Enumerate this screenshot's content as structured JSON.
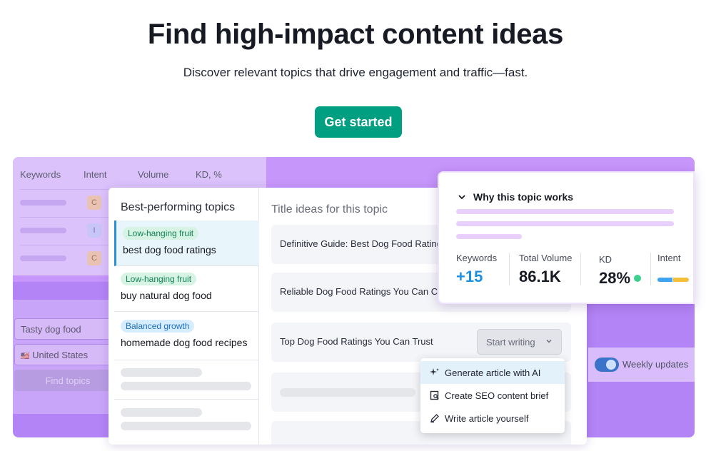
{
  "hero": {
    "title": "Find high-impact content ideas",
    "subtitle": "Discover relevant topics that drive engagement and traffic—fast.",
    "cta_label": "Get started"
  },
  "back_table": {
    "headers": [
      "Keywords",
      "Intent",
      "Volume",
      "KD, %"
    ],
    "badges": [
      "C",
      "I",
      "C"
    ]
  },
  "back_form": {
    "topic_value": "Tasty dog food",
    "country_value": "United States",
    "flag": "🇺🇸",
    "button_label": "Find topics"
  },
  "topics_panel": {
    "title": "Best-performing topics",
    "topics": [
      {
        "tag": "Low-hanging fruit",
        "name": "best dog food ratings"
      },
      {
        "tag": "Low-hanging fruit",
        "name": "buy natural dog food"
      },
      {
        "tag": "Balanced growth",
        "name": "homemade dog food recipes"
      }
    ]
  },
  "ideas_panel": {
    "title": "Title ideas for this topic",
    "ideas": [
      "Definitive Guide: Best Dog Food Ratings",
      "Reliable Dog Food Ratings You Can Count On",
      "Top Dog Food Ratings You Can Trust"
    ],
    "start_writing_label": "Start writing"
  },
  "dropdown": {
    "items": [
      "Generate article with AI",
      "Create SEO content brief",
      "Write article yourself"
    ]
  },
  "why_card": {
    "title": "Why this topic works",
    "metrics": [
      {
        "label": "Keywords",
        "value": "+15"
      },
      {
        "label": "Total Volume",
        "value": "86.1K"
      },
      {
        "label": "KD",
        "value": "28%"
      },
      {
        "label": "Intent",
        "value": ""
      }
    ]
  },
  "weekly": {
    "label": "Weekly updates",
    "enabled": true
  },
  "colors": {
    "cta": "#009f81",
    "stage": "#b384f5",
    "accent_blue": "#1d8fe1",
    "kd_dot": "#3ccf8e"
  }
}
